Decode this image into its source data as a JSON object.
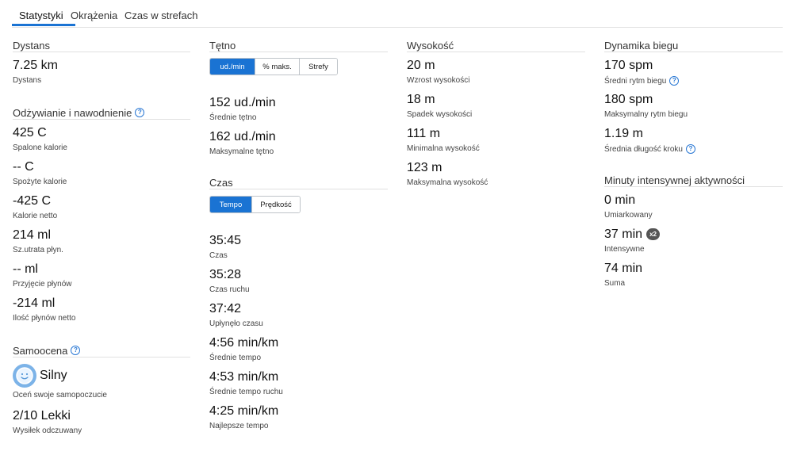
{
  "tabs": [
    {
      "label": "Statystyki"
    },
    {
      "label": "Okrążenia"
    },
    {
      "label": "Czas w strefach"
    }
  ],
  "col1": {
    "distance": {
      "title": "Dystans",
      "value": "7.25 km",
      "label": "Dystans"
    },
    "nutrition": {
      "title": "Odżywianie i nawodnienie",
      "items": [
        {
          "value": "425 C",
          "label": "Spalone kalorie"
        },
        {
          "value": "-- C",
          "label": "Spożyte kalorie"
        },
        {
          "value": "-425 C",
          "label": "Kalorie netto"
        },
        {
          "value": "214 ml",
          "label": "Sz.utrata płyn."
        },
        {
          "value": "-- ml",
          "label": "Przyjęcie płynów"
        },
        {
          "value": "-214 ml",
          "label": "Ilość płynów netto"
        }
      ]
    },
    "self": {
      "title": "Samoocena",
      "feeling_value": "Silny",
      "feeling_label": "Oceń swoje samopoczucie",
      "effort_value": "2/10 Lekki",
      "effort_label": "Wysiłek odczuwany"
    }
  },
  "col2": {
    "hr": {
      "title": "Tętno",
      "buttons": [
        "ud./min",
        "% maks.",
        "Strefy"
      ],
      "items": [
        {
          "value": "152 ud./min",
          "label": "Średnie tętno"
        },
        {
          "value": "162 ud./min",
          "label": "Maksymalne tętno"
        }
      ]
    },
    "time": {
      "title": "Czas",
      "buttons": [
        "Tempo",
        "Prędkość"
      ],
      "items": [
        {
          "value": "35:45",
          "label": "Czas"
        },
        {
          "value": "35:28",
          "label": "Czas ruchu"
        },
        {
          "value": "37:42",
          "label": "Upłynęło czasu"
        },
        {
          "value": "4:56 min/km",
          "label": "Średnie tempo"
        },
        {
          "value": "4:53 min/km",
          "label": "Średnie tempo ruchu"
        },
        {
          "value": "4:25 min/km",
          "label": "Najlepsze tempo"
        }
      ]
    }
  },
  "col3": {
    "elevation": {
      "title": "Wysokość",
      "items": [
        {
          "value": "20 m",
          "label": "Wzrost wysokości"
        },
        {
          "value": "18 m",
          "label": "Spadek wysokości"
        },
        {
          "value": "111 m",
          "label": "Minimalna wysokość"
        },
        {
          "value": "123 m",
          "label": "Maksymalna wysokość"
        }
      ]
    }
  },
  "col4": {
    "dynamics": {
      "title": "Dynamika biegu",
      "items": [
        {
          "value": "170 spm",
          "label": "Średni rytm biegu"
        },
        {
          "value": "180 spm",
          "label": "Maksymalny rytm biegu"
        },
        {
          "value": "1.19 m",
          "label": "Średnia długość kroku"
        }
      ]
    },
    "intensity": {
      "title": "Minuty intensywnej aktywności",
      "items": [
        {
          "value": "0 min",
          "label": "Umiarkowany"
        },
        {
          "value": "37 min",
          "label": "Intensywne",
          "badge": "x2"
        },
        {
          "value": "74 min",
          "label": "Suma"
        }
      ]
    }
  },
  "colors": {
    "accent": "#1a73d3",
    "badge": "#555555",
    "avatar": "#7cb3e8"
  },
  "icons": {
    "help": "question-circle-icon",
    "avatar": "smiley-face-icon"
  }
}
